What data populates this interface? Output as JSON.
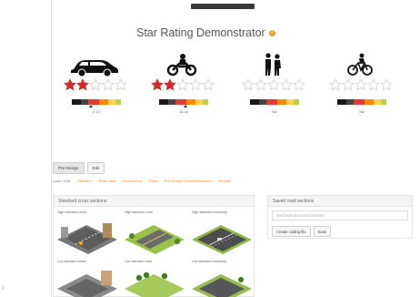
{
  "page": {
    "title": "Star Rating Demonstrator",
    "info_icon": "info-icon",
    "edge_mark": "1"
  },
  "modes": [
    {
      "name": "Car",
      "icon": "car-icon",
      "rating_stars": 2,
      "meter_label": "2.72",
      "marker_position": 0.4
    },
    {
      "name": "Motorcycle",
      "icon": "motorcycle-icon",
      "rating_stars": 2,
      "meter_label": "16.34",
      "marker_position": 0.55
    },
    {
      "name": "Pedestrian",
      "icon": "pedestrian-icon",
      "rating_stars": 0,
      "meter_label": "NA",
      "marker_position": null
    },
    {
      "name": "Bicycle",
      "icon": "bicycle-icon",
      "rating_stars": 0,
      "meter_label": "NA",
      "marker_position": null
    }
  ],
  "tabs": [
    {
      "label": "Pre-Design",
      "active": true
    },
    {
      "label": "Edit",
      "active": false
    }
  ],
  "load_row": {
    "prefix": "Load / Edit:",
    "links": [
      "Selection",
      "Road data",
      "Intersections",
      "Risks",
      "Pre-Design Countermeasures",
      "Results"
    ]
  },
  "left_panel": {
    "title": "Standard cross sections",
    "roads": [
      {
        "label": "High standard urban",
        "variant": "urban"
      },
      {
        "label": "High standard rural",
        "variant": "rural"
      },
      {
        "label": "High standard motorway",
        "variant": "motorway"
      },
      {
        "label": "Low standard urban",
        "variant": "urban"
      },
      {
        "label": "Low standard rural",
        "variant": "rural"
      },
      {
        "label": "Low standard motorway",
        "variant": "motorway"
      }
    ]
  },
  "right_panel": {
    "title": "Saved road sections",
    "search_placeholder": "You have no saved sections...",
    "buttons": [
      "Create coding file",
      "Save"
    ]
  },
  "colors": {
    "star_filled": "#d42a2a",
    "star_empty": "#cfcfcf",
    "meter": [
      "#1a1a1a",
      "#444444",
      "#e53935",
      "#ff8a00",
      "#ffd54f",
      "#b8d04a"
    ],
    "accent": "#f08a24"
  }
}
